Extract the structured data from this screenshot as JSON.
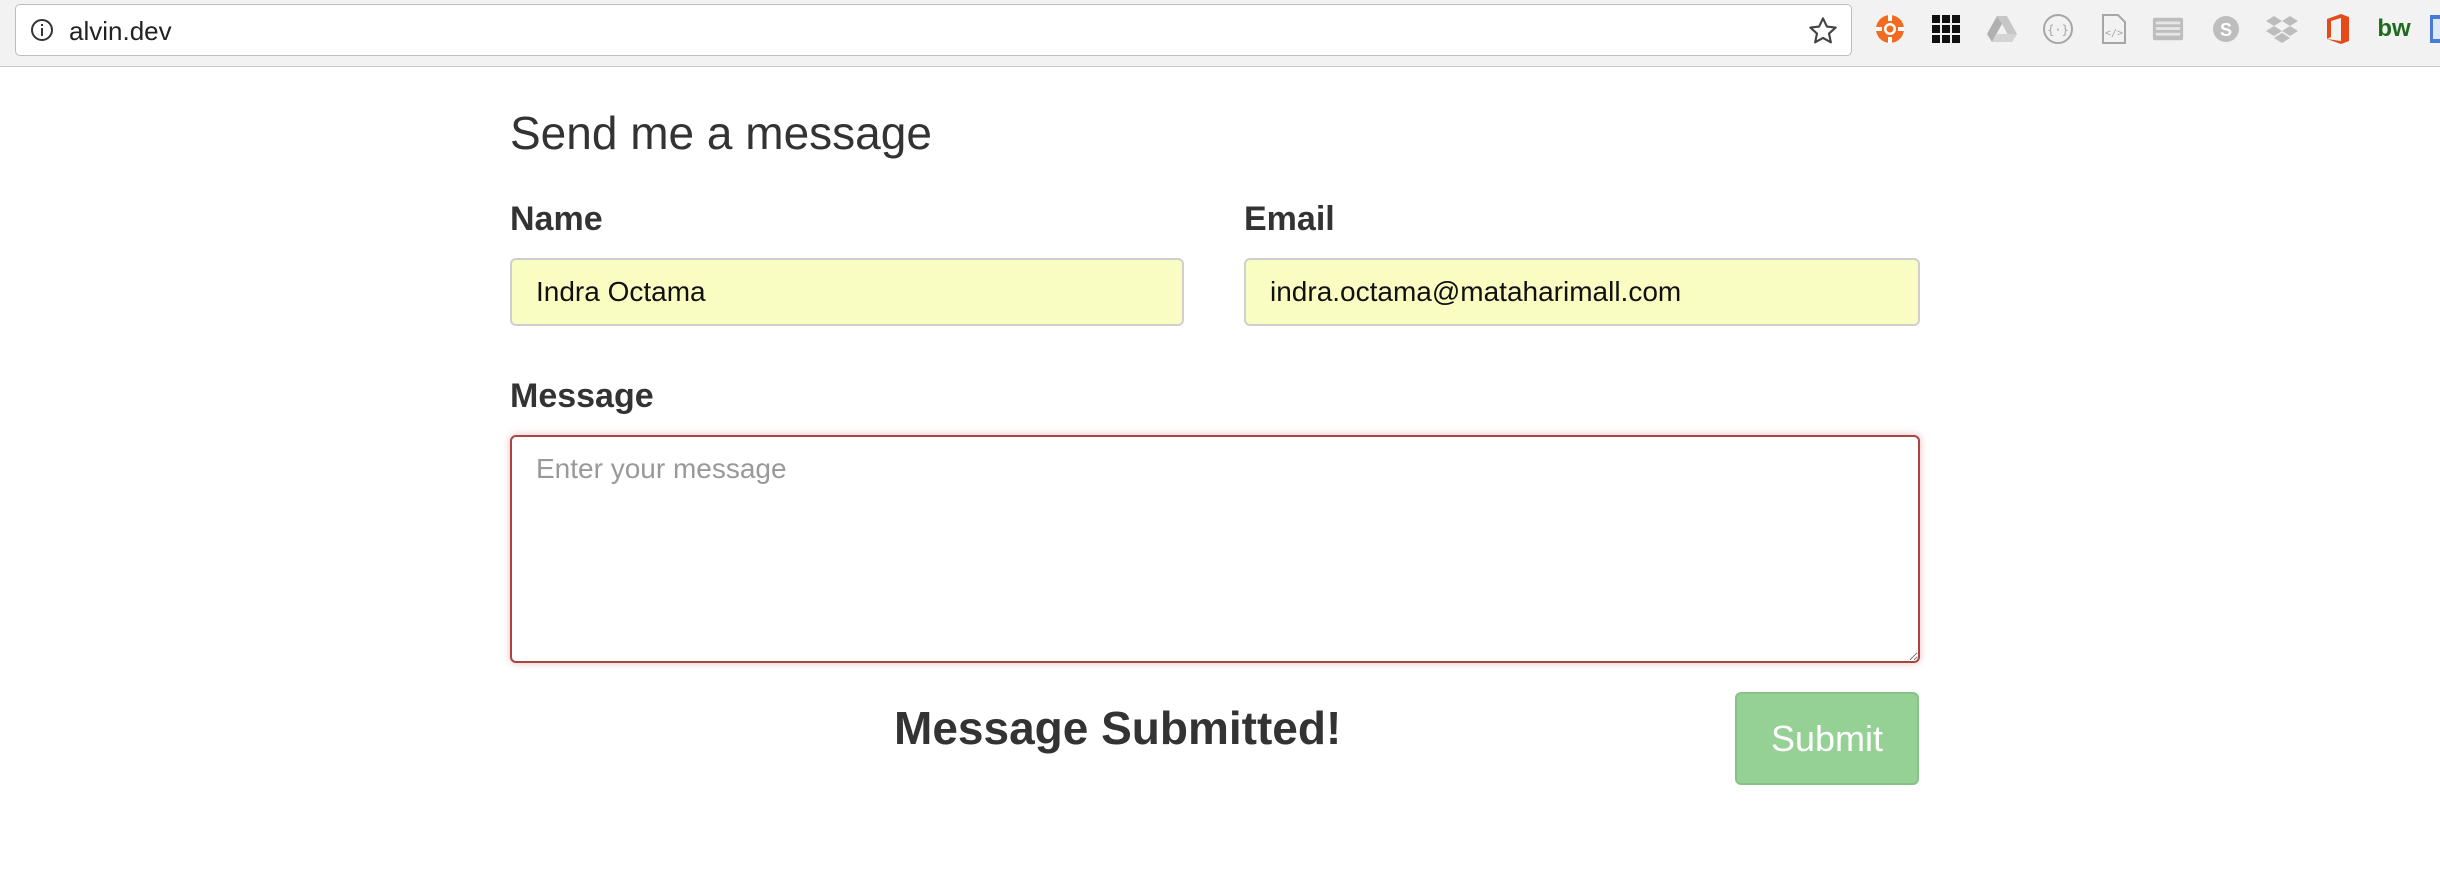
{
  "browser": {
    "url": "alvin.dev",
    "extensions": [
      {
        "name": "lifebuoy-icon",
        "color": "#f26b21"
      },
      {
        "name": "grid-icon",
        "color": "#111111"
      },
      {
        "name": "drive-icon",
        "color": "#bdbdbd"
      },
      {
        "name": "code-braces-icon",
        "color": "#9e9e9e"
      },
      {
        "name": "code-file-icon",
        "color": "#9e9e9e"
      },
      {
        "name": "keyboard-icon",
        "color": "#9e9e9e"
      },
      {
        "name": "skype-icon",
        "color": "#bdbdbd"
      },
      {
        "name": "dropbox-icon",
        "color": "#bdbdbd"
      },
      {
        "name": "office-icon",
        "color": "#e64a19"
      },
      {
        "name": "bw-icon",
        "label": "bw",
        "color": "#1e6b1e"
      },
      {
        "name": "partial-extension-icon",
        "color": "#4a7bd4"
      }
    ]
  },
  "form": {
    "title": "Send me a message",
    "name": {
      "label": "Name",
      "value": "Indra Octama"
    },
    "email": {
      "label": "Email",
      "value": "indra.octama@mataharimall.com"
    },
    "message": {
      "label": "Message",
      "placeholder": "Enter your message",
      "value": ""
    },
    "status": "Message Submitted!",
    "submit_label": "Submit"
  },
  "colors": {
    "autofill_bg": "#fafdc1",
    "error_border": "#a94442",
    "submit_bg": "#95d095"
  }
}
